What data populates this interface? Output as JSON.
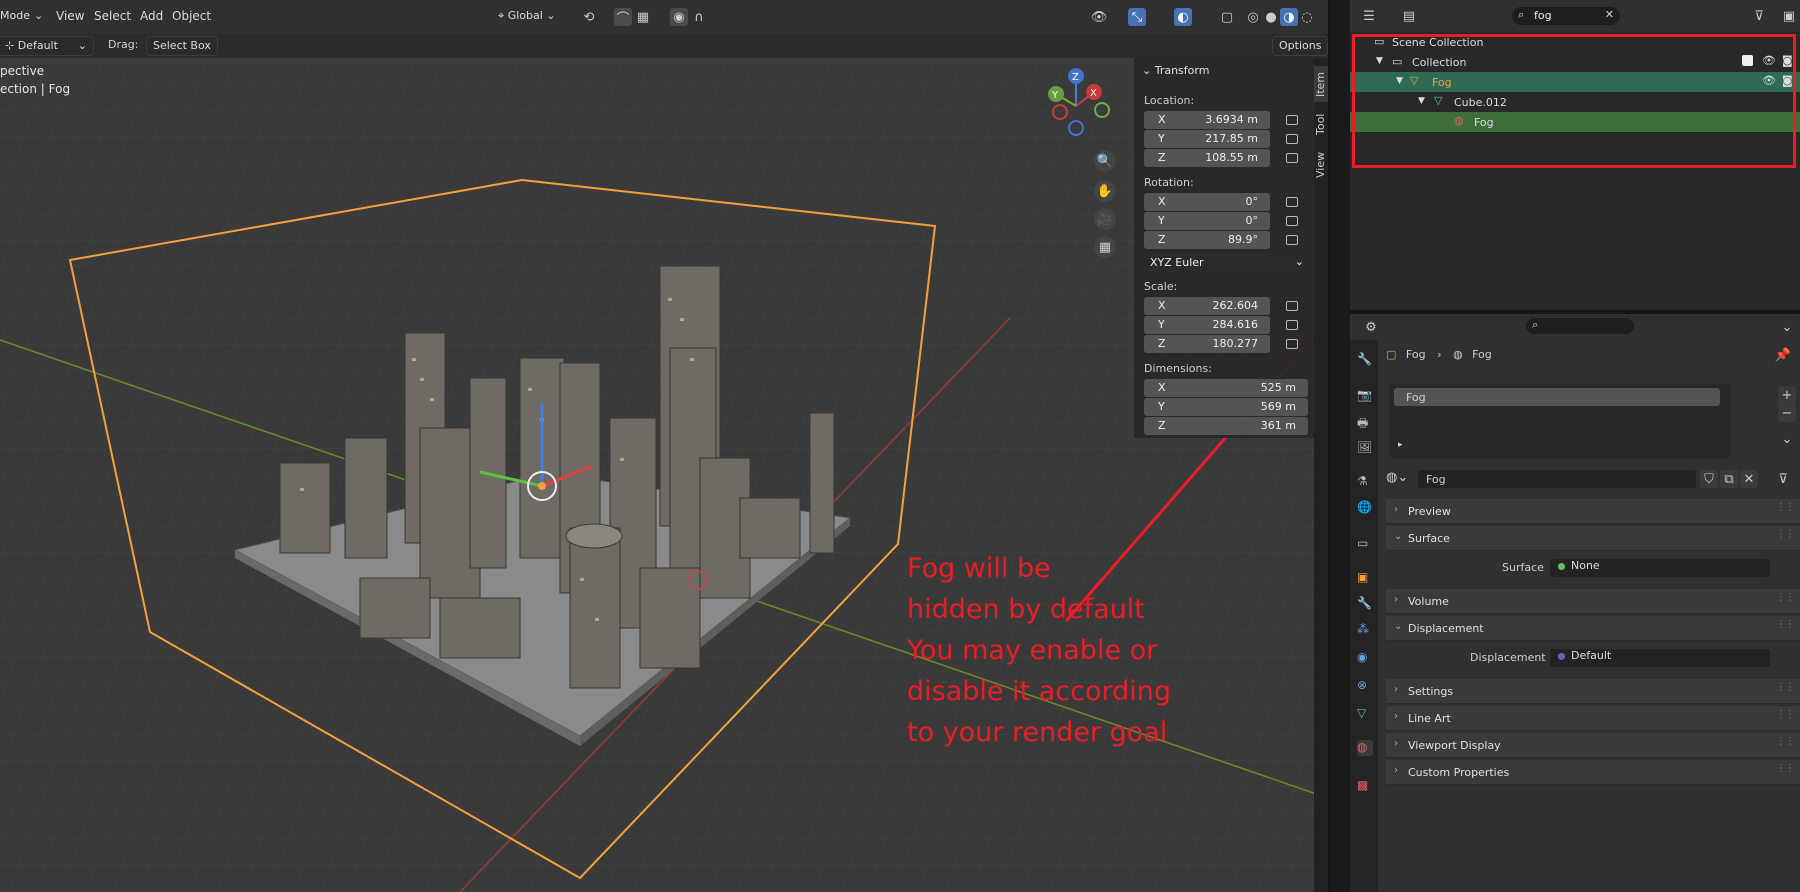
{
  "header": {
    "mode": "Mode",
    "menus": [
      "View",
      "Select",
      "Add",
      "Object"
    ],
    "transform_orientation": "Global",
    "pivot_icon": "pivot-icon",
    "snap_icon": "magnet-icon"
  },
  "toolbar": {
    "orientation_label": "Default",
    "drag_label": "Drag:",
    "drag_value": "Select Box",
    "options_label": "Options"
  },
  "viewport": {
    "view_name": "pective",
    "collection_path": "ection | Fog",
    "gizmo_axes": [
      "X",
      "Y",
      "Z"
    ],
    "tabs": [
      "Item",
      "Tool",
      "View"
    ]
  },
  "transform": {
    "title": "Transform",
    "location_label": "Location:",
    "location": [
      {
        "axis": "X",
        "value": "3.6934 m"
      },
      {
        "axis": "Y",
        "value": "217.85 m"
      },
      {
        "axis": "Z",
        "value": "108.55 m"
      }
    ],
    "rotation_label": "Rotation:",
    "rotation": [
      {
        "axis": "X",
        "value": "0°"
      },
      {
        "axis": "Y",
        "value": "0°"
      },
      {
        "axis": "Z",
        "value": "89.9°"
      }
    ],
    "rotation_mode": "XYZ Euler",
    "scale_label": "Scale:",
    "scale": [
      {
        "axis": "X",
        "value": "262.604"
      },
      {
        "axis": "Y",
        "value": "284.616"
      },
      {
        "axis": "Z",
        "value": "180.277"
      }
    ],
    "dimensions_label": "Dimensions:",
    "dimensions": [
      {
        "axis": "X",
        "value": "525 m"
      },
      {
        "axis": "Y",
        "value": "569 m"
      },
      {
        "axis": "Z",
        "value": "361 m"
      }
    ]
  },
  "outliner": {
    "search_value": "fog",
    "rows": [
      {
        "label": "Scene Collection"
      },
      {
        "label": "Collection"
      },
      {
        "label": "Fog"
      },
      {
        "label": "Cube.012"
      },
      {
        "label": "Fog"
      }
    ]
  },
  "properties": {
    "breadcrumb": [
      "Fog",
      "Fog"
    ],
    "material_slot": "Fog",
    "material_name": "Fog",
    "sections": {
      "preview": "Preview",
      "surface": "Surface",
      "surface_label": "Surface",
      "surface_value": "None",
      "volume": "Volume",
      "displacement": "Displacement",
      "displacement_label": "Displacement",
      "displacement_value": "Default",
      "settings": "Settings",
      "line_art": "Line Art",
      "viewport_display": "Viewport Display",
      "custom_properties": "Custom Properties"
    }
  },
  "annotation": {
    "lines": [
      "Fog will be",
      "hidden by default",
      "You may enable or",
      "disable it according",
      "to your render goal"
    ],
    "color": "#ec1c24"
  },
  "colors": {
    "selection_orange": "#f4a13a",
    "outliner_highlight": "#2f6a55",
    "outliner_active_row": "#3d6f3a"
  }
}
